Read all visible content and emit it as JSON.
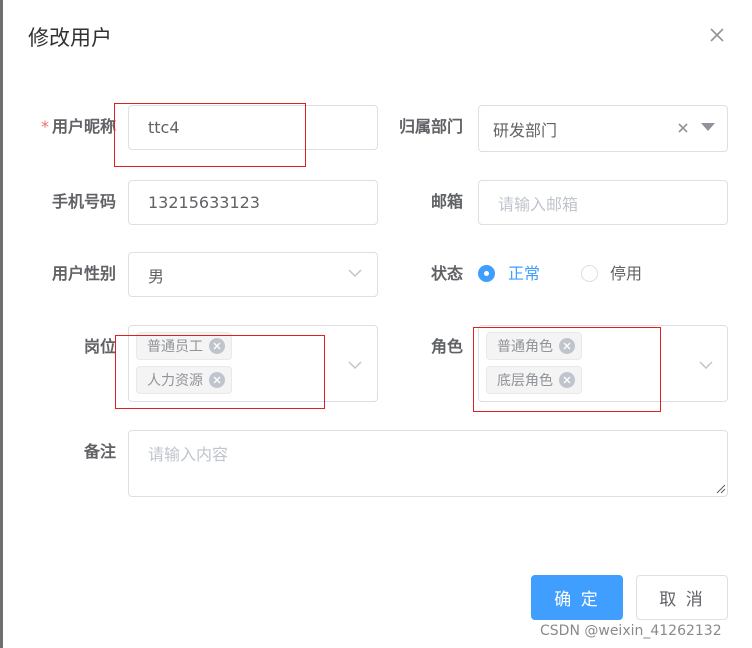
{
  "dialog": {
    "title": "修改用户"
  },
  "form": {
    "nickname": {
      "label": "用户昵称",
      "required_mark": "*",
      "value": "ttc4"
    },
    "dept": {
      "label": "归属部门",
      "value": "研发部门"
    },
    "phone": {
      "label": "手机号码",
      "value": "13215633123"
    },
    "email": {
      "label": "邮箱",
      "placeholder": "请输入邮箱"
    },
    "sex": {
      "label": "用户性别",
      "value": "男"
    },
    "status": {
      "label": "状态",
      "options": [
        "正常",
        "停用"
      ],
      "selected": "正常"
    },
    "post": {
      "label": "岗位",
      "tags": [
        "普通员工",
        "人力资源"
      ]
    },
    "role": {
      "label": "角色",
      "tags": [
        "普通角色",
        "底层角色"
      ]
    },
    "remark": {
      "label": "备注",
      "placeholder": "请输入内容"
    }
  },
  "footer": {
    "confirm_label": "确 定",
    "cancel_label": "取 消"
  },
  "watermark": "CSDN @weixin_41262132",
  "icons": {
    "close": "close-icon",
    "arrow": "chevron-down-icon",
    "clear": "clear-icon",
    "tag_close": "tag-close-icon"
  },
  "colors": {
    "primary": "#409eff",
    "required": "#f56c6c",
    "annotation": "#e02020"
  }
}
